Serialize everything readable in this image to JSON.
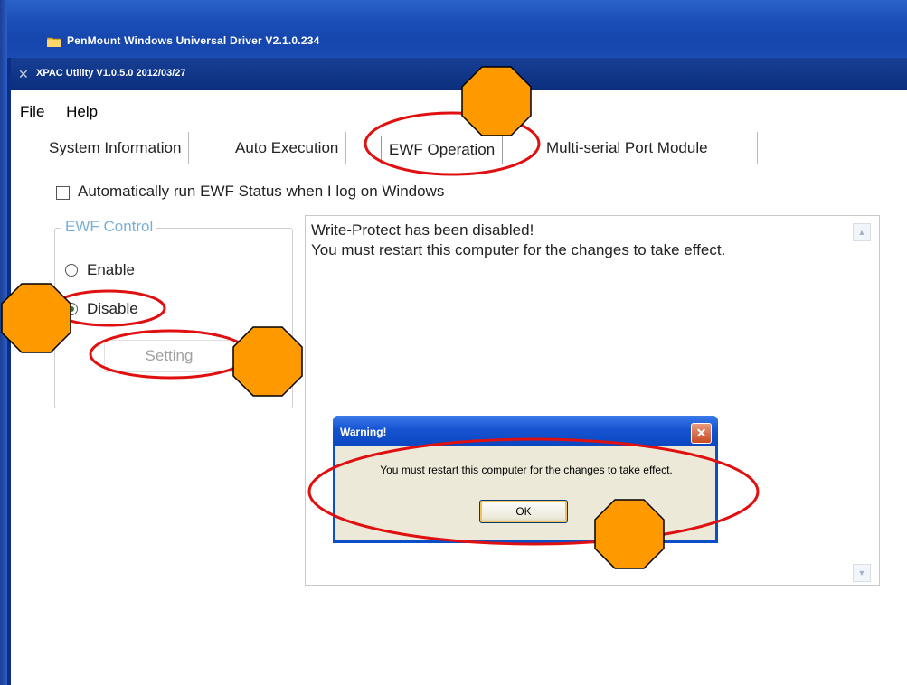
{
  "outer_window": {
    "title": "PenMount Windows Universal Driver V2.1.0.234"
  },
  "app_window": {
    "title": "XPAC Utility V1.0.5.0  2012/03/27"
  },
  "menu": [
    {
      "label": "File"
    },
    {
      "label": "Help"
    }
  ],
  "tabs": [
    {
      "label": "System Information"
    },
    {
      "label": "Auto Execution"
    },
    {
      "label": "EWF Operation",
      "active": true
    },
    {
      "label": "Multi-serial Port Module"
    }
  ],
  "auto_run": {
    "label": "Automatically run EWF Status when I log on Windows",
    "checked": false
  },
  "ewf_control": {
    "title": "EWF Control",
    "enable_label": "Enable",
    "disable_label": "Disable",
    "selected": "Disable",
    "setting_label": "Setting"
  },
  "status_text": {
    "line1": "Write-Protect has been disabled!",
    "line2": "You must restart this computer for the changes to take effect."
  },
  "warning_dialog": {
    "title": "Warning!",
    "message": "You must restart this computer for the changes to take effect.",
    "ok_label": "OK"
  },
  "colors": {
    "annotation_marker": "#ff9900",
    "annotation_ring": "#e01010",
    "title_blue": "#0c2e7d"
  }
}
